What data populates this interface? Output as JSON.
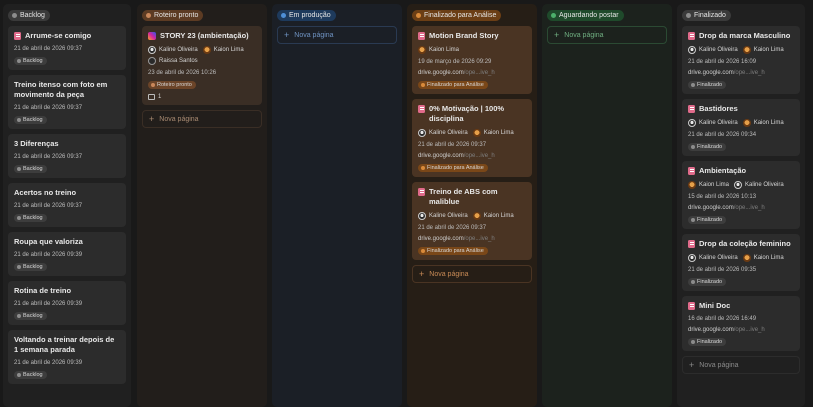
{
  "columns": {
    "backlog": {
      "label": "Backlog",
      "cards": [
        {
          "title": "Arrume-se comigo",
          "date": "21 de abril de 2026 09:37",
          "tag": "Backlog"
        },
        {
          "title": "Treino itenso com foto em movimento da peça",
          "date": "21 de abril de 2026 09:37",
          "tag": "Backlog"
        },
        {
          "title": "3 Diferenças",
          "date": "21 de abril de 2026 09:37",
          "tag": "Backlog"
        },
        {
          "title": "Acertos no treino",
          "date": "21 de abril de 2026 09:37",
          "tag": "Backlog"
        },
        {
          "title": "Roupa que valoriza",
          "date": "21 de abril de 2026 09:39",
          "tag": "Backlog"
        },
        {
          "title": "Rotina de treino",
          "date": "21 de abril de 2026 09:39",
          "tag": "Backlog"
        },
        {
          "title": "Voltando a treinar depois de 1 semana parada",
          "date": "21 de abril de 2026 09:39",
          "tag": "Backlog"
        }
      ]
    },
    "roteiro": {
      "label": "Roteiro pronto",
      "card": {
        "title": "STORY 23 (ambientação)",
        "person1": "Kaline Oliveira",
        "person2": "Kaion Lima",
        "person3": "Raissa Santos",
        "date": "23 de abril de 2026 10:26",
        "tag": "Roteiro pronto",
        "comments": "1"
      },
      "new_page": "Nova página"
    },
    "producao": {
      "label": "Em produção",
      "new_page": "Nova página"
    },
    "final": {
      "label": "Finalizado para Análise",
      "cards": [
        {
          "title": "Motion Brand Story",
          "person1": "Kaion Lima",
          "person2": "",
          "date": "19 de março de 2026 09:29",
          "link": "drive.google.com",
          "link_dim": "/ope...ive_h",
          "tag": "Finalizado para Análise"
        },
        {
          "title": "0% Motivação | 100% disciplina",
          "person1": "Kaline Oliveira",
          "person2": "Kaion Lima",
          "date": "21 de abril de 2026 09:37",
          "link": "drive.google.com",
          "link_dim": "/ope...ive_h",
          "tag": "Finalizado para Análise"
        },
        {
          "title": "Treino de ABS com maliblue",
          "person1": "Kaline Oliveira",
          "person2": "Kaion Lima",
          "date": "21 de abril de 2026 09:37",
          "link": "drive.google.com",
          "link_dim": "/ope...ive_h",
          "tag": "Finalizado para Análise"
        }
      ],
      "new_page": "Nova página"
    },
    "aguard": {
      "label": "Aguardando postar",
      "new_page": "Nova página"
    },
    "finalizado": {
      "label": "Finalizado",
      "cards": [
        {
          "title": "Drop da marca Masculino",
          "person1": "Kaline Oliveira",
          "person2": "Kaion Lima",
          "date": "21 de abril de 2026 16:09",
          "link": "drive.google.com",
          "link_dim": "/ope...ive_h",
          "tag": "Finalizado"
        },
        {
          "title": "Bastidores",
          "person1": "Kaline Oliveira",
          "person2": "Kaion Lima",
          "date": "21 de abril de 2026 09:34",
          "link": "",
          "link_dim": "",
          "tag": "Finalizado"
        },
        {
          "title": "Ambientação",
          "person1": "Kaion Lima",
          "person2": "Kaline Oliveira",
          "date": "15 de abril de 2026 10:13",
          "link": "drive.google.com",
          "link_dim": "/ope...ive_h",
          "tag": "Finalizado"
        },
        {
          "title": "Drop da coleção feminino",
          "person1": "Kaline Oliveira",
          "person2": "Kaion Lima",
          "date": "21 de abril de 2026 09:35",
          "link": "",
          "link_dim": "",
          "tag": "Finalizado"
        },
        {
          "title": "Mini Doc",
          "person1": "",
          "person2": "",
          "date": "16 de abril de 2026 16:49",
          "link": "drive.google.com",
          "link_dim": "/ope...ive_h",
          "tag": "Finalizado"
        }
      ],
      "new_page": "Nova página"
    }
  }
}
